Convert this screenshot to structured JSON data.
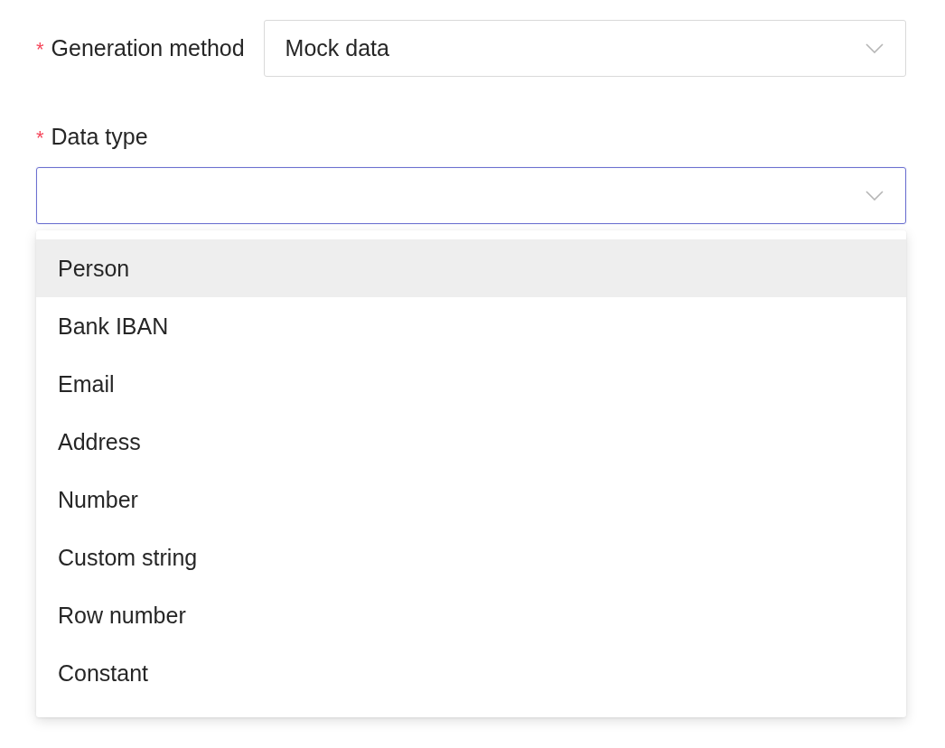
{
  "fields": [
    {
      "kind": "inline",
      "required_mark": "*",
      "label": "Generation method",
      "value": "Mock data",
      "focused": false
    },
    {
      "kind": "stacked",
      "required_mark": "*",
      "label": "Data type",
      "focused": true
    }
  ],
  "dropdown": {
    "options": [
      {
        "label": "Person",
        "highlighted": true
      },
      {
        "label": "Bank IBAN",
        "highlighted": false
      },
      {
        "label": "Email",
        "highlighted": false
      },
      {
        "label": "Address",
        "highlighted": false
      },
      {
        "label": "Number",
        "highlighted": false
      },
      {
        "label": "Custom string",
        "highlighted": false
      },
      {
        "label": "Row number",
        "highlighted": false
      },
      {
        "label": "Constant",
        "highlighted": false
      }
    ]
  }
}
